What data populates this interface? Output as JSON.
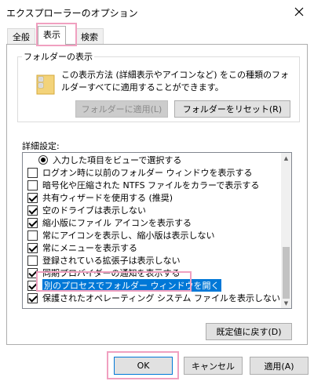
{
  "window": {
    "title": "エクスプローラーのオプション"
  },
  "tabs": [
    {
      "label": "全般"
    },
    {
      "label": "表示"
    },
    {
      "label": "検索"
    }
  ],
  "folder_view": {
    "group_label": "フォルダーの表示",
    "description": "この表示方法 (詳細表示やアイコンなど) をこの種類のフォルダーすべてに適用することができます。",
    "apply_button": "フォルダーに適用(L)",
    "reset_button": "フォルダーをリセット(R)"
  },
  "advanced": {
    "label": "詳細設定:",
    "items": [
      {
        "type": "radio",
        "label": "入力した項目をビューで選択する",
        "checked": true
      },
      {
        "type": "checkbox",
        "label": "ログオン時に以前のフォルダー ウィンドウを表示する",
        "checked": false
      },
      {
        "type": "checkbox",
        "label": "暗号化や圧縮された NTFS ファイルをカラーで表示する",
        "checked": false
      },
      {
        "type": "checkbox",
        "label": "共有ウィザードを使用する (推奨)",
        "checked": true
      },
      {
        "type": "checkbox",
        "label": "空のドライブは表示しない",
        "checked": true
      },
      {
        "type": "checkbox",
        "label": "縮小版にファイル アイコンを表示する",
        "checked": true
      },
      {
        "type": "checkbox",
        "label": "常にアイコンを表示し、縮小版は表示しない",
        "checked": false
      },
      {
        "type": "checkbox",
        "label": "常にメニューを表示する",
        "checked": true
      },
      {
        "type": "checkbox",
        "label": "登録されている拡張子は表示しない",
        "checked": false
      },
      {
        "type": "checkbox",
        "label": "同期プロバイダーの通知を表示する",
        "checked": true
      },
      {
        "type": "checkbox",
        "label": "別のプロセスでフォルダー ウィンドウを開く",
        "checked": true,
        "selected": true
      },
      {
        "type": "checkbox",
        "label": "保護されたオペレーティング システム ファイルを表示しない (推奨)",
        "checked": true
      }
    ],
    "restore_button": "既定値に戻す(D)"
  },
  "footer": {
    "ok": "OK",
    "cancel": "キャンセル",
    "apply": "適用(A)"
  },
  "colors": {
    "selection": "#0078d7",
    "highlight": "#f0a0c0"
  }
}
